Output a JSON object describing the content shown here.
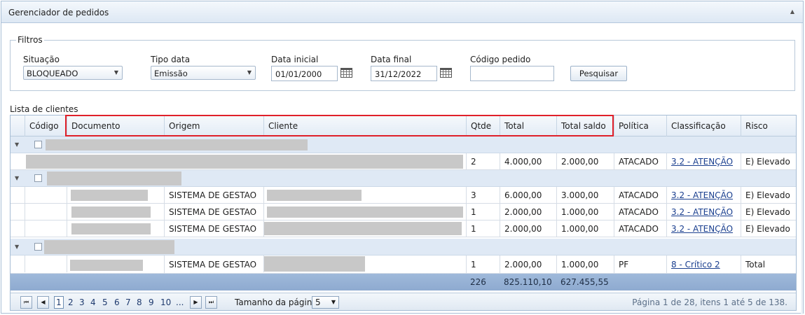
{
  "panel": {
    "title": "Gerenciador de pedidos"
  },
  "filters": {
    "legend": "Filtros",
    "situacao": {
      "label": "Situação",
      "value": "BLOQUEADO"
    },
    "tipo_data": {
      "label": "Tipo data",
      "value": "Emissão"
    },
    "data_inicial": {
      "label": "Data inicial",
      "value": "01/01/2000"
    },
    "data_final": {
      "label": "Data final",
      "value": "31/12/2022"
    },
    "codigo_pedido": {
      "label": "Código pedido",
      "value": ""
    },
    "search_button": "Pesquisar"
  },
  "list": {
    "label": "Lista de clientes"
  },
  "columns": {
    "codigo": "Código",
    "documento": "Documento",
    "origem": "Origem",
    "cliente": "Cliente",
    "qtde": "Qtde",
    "total": "Total",
    "total_saldo": "Total saldo",
    "politica": "Política",
    "classificacao": "Classificação",
    "risco": "Risco"
  },
  "rows": [
    {
      "origem": "",
      "qtde": "2",
      "total": "4.000,00",
      "saldo": "2.000,00",
      "politica": "ATACADO",
      "classificacao": "3.2 - ATENÇÃO",
      "risco": "E) Elevado"
    },
    {
      "origem": "SISTEMA DE GESTAO",
      "qtde": "3",
      "total": "6.000,00",
      "saldo": "3.000,00",
      "politica": "ATACADO",
      "classificacao": "3.2 - ATENÇÃO",
      "risco": "E) Elevado"
    },
    {
      "origem": "SISTEMA DE GESTAO",
      "qtde": "1",
      "total": "2.000,00",
      "saldo": "1.000,00",
      "politica": "ATACADO",
      "classificacao": "3.2 - ATENÇÃO",
      "risco": "E) Elevado"
    },
    {
      "origem": "SISTEMA DE GESTAO",
      "qtde": "1",
      "total": "2.000,00",
      "saldo": "1.000,00",
      "politica": "ATACADO",
      "classificacao": "3.2 - ATENÇÃO",
      "risco": "E) Elevado"
    },
    {
      "origem": "SISTEMA DE GESTAO",
      "qtde": "1",
      "total": "2.000,00",
      "saldo": "1.000,00",
      "politica": "PF",
      "classificacao": "8 - Crítico 2",
      "risco": "Total"
    }
  ],
  "totals": {
    "qtde": "226",
    "total": "825.110,10",
    "saldo": "627.455,55"
  },
  "pager": {
    "pages": [
      "1",
      "2",
      "3",
      "4",
      "5",
      "6",
      "7",
      "8",
      "9",
      "10",
      "..."
    ],
    "page_size_label": "Tamanho da página:",
    "page_size": "5",
    "info": "Página 1 de 28, itens 1 até 5 de 138."
  },
  "colors": {
    "highlight": "#e0202a",
    "footer": "#9fb9da",
    "link": "#1a3f8f"
  }
}
